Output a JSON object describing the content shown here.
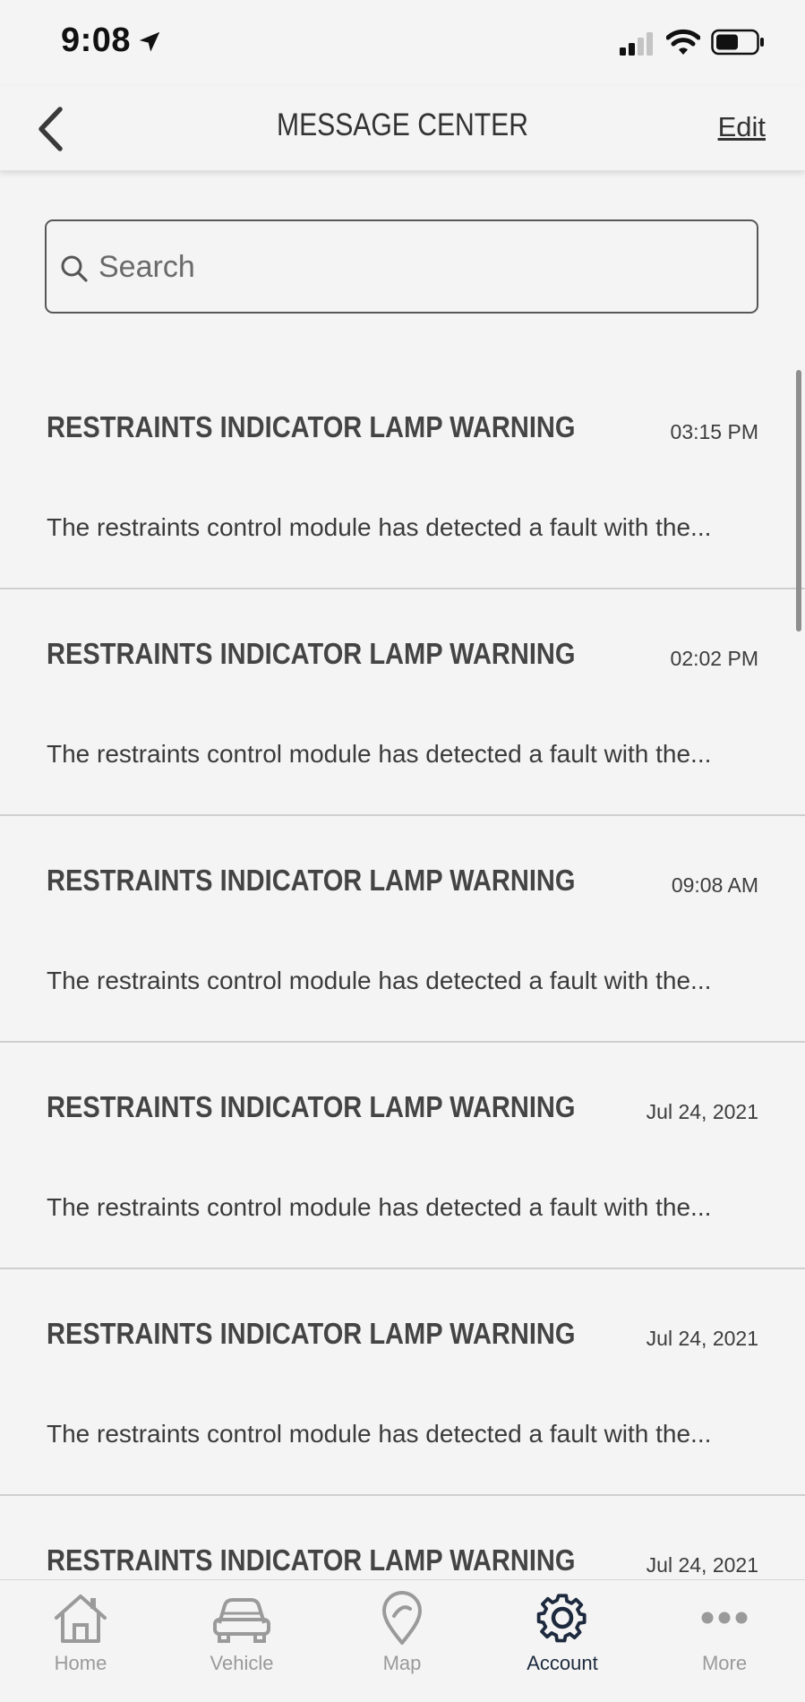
{
  "status_bar": {
    "time": "9:08"
  },
  "header": {
    "title": "MESSAGE CENTER",
    "edit_label": "Edit"
  },
  "search": {
    "placeholder": "Search",
    "value": ""
  },
  "messages": [
    {
      "title": "RESTRAINTS INDICATOR LAMP WARNING",
      "time": "03:15 PM",
      "body": "The restraints control module has detected a fault with the..."
    },
    {
      "title": "RESTRAINTS INDICATOR LAMP WARNING",
      "time": "02:02 PM",
      "body": "The restraints control module has detected a fault with the..."
    },
    {
      "title": "RESTRAINTS INDICATOR LAMP WARNING",
      "time": "09:08 AM",
      "body": "The restraints control module has detected a fault with the..."
    },
    {
      "title": "RESTRAINTS INDICATOR LAMP WARNING",
      "time": "Jul 24, 2021",
      "body": "The restraints control module has detected a fault with the..."
    },
    {
      "title": "RESTRAINTS INDICATOR LAMP WARNING",
      "time": "Jul 24, 2021",
      "body": "The restraints control module has detected a fault with the..."
    },
    {
      "title": "RESTRAINTS INDICATOR LAMP WARNING",
      "time": "Jul 24, 2021",
      "body": ""
    }
  ],
  "tabs": [
    {
      "label": "Home",
      "icon": "home-icon",
      "active": false
    },
    {
      "label": "Vehicle",
      "icon": "car-icon",
      "active": false
    },
    {
      "label": "Map",
      "icon": "map-pin-icon",
      "active": false
    },
    {
      "label": "Account",
      "icon": "gear-icon",
      "active": true
    },
    {
      "label": "More",
      "icon": "more-dots-icon",
      "active": false
    }
  ],
  "colors": {
    "background": "#f4f4f4",
    "active_tab": "#1d2a3e",
    "inactive_tab": "#9a9a9a"
  }
}
